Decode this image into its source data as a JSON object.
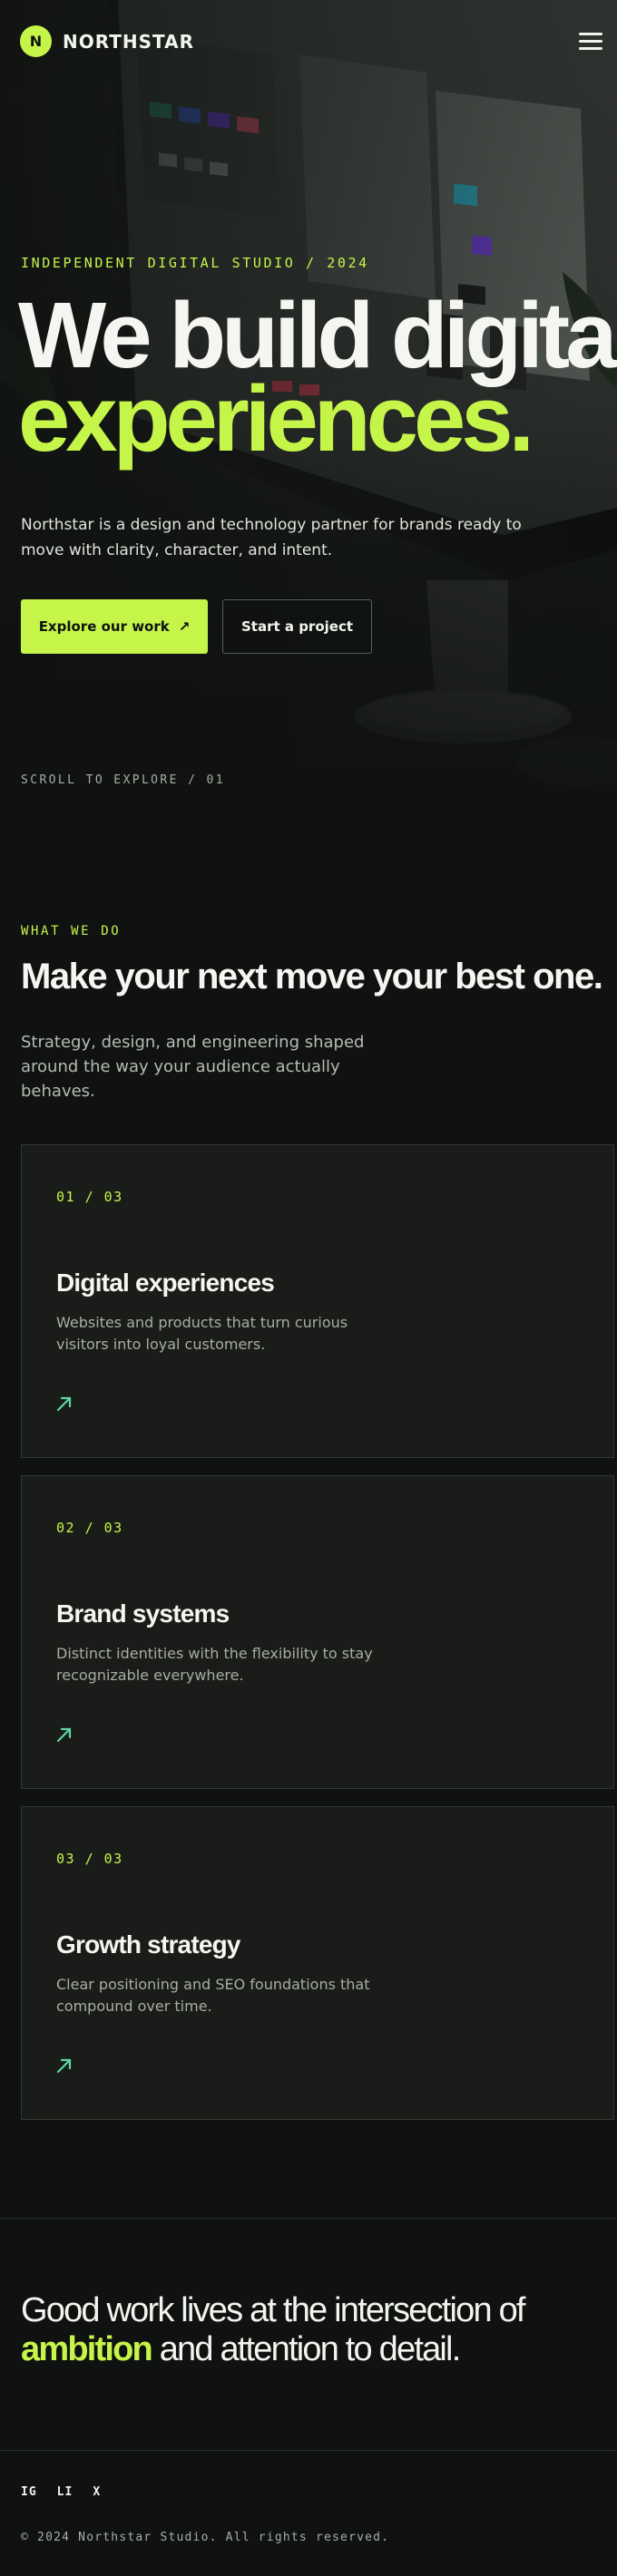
{
  "brand": {
    "mark": "N",
    "name": "NORTHSTAR"
  },
  "hero": {
    "eyebrow": "INDEPENDENT DIGITAL STUDIO / 2024",
    "title_line1": "We build digital",
    "title_line2": "experiences.",
    "lead": "Northstar is a design and technology partner for brands ready to move with clarity, character, and intent.",
    "primary_label": "Explore our work",
    "primary_arrow": "↗",
    "secondary_label": "Start a project",
    "scroll_cue": "SCROLL TO EXPLORE / 01"
  },
  "services": {
    "eyebrow": "WHAT WE DO",
    "title": "Make your next move your best one.",
    "lead": "Strategy, design, and engineering shaped around the way your audience actually behaves.",
    "items": [
      {
        "index": "01 / 03",
        "title": "Digital experiences",
        "desc": "Websites and products that turn curious visitors into loyal customers."
      },
      {
        "index": "02 / 03",
        "title": "Brand systems",
        "desc": "Distinct identities with the flexibility to stay recognizable everywhere."
      },
      {
        "index": "03 / 03",
        "title": "Growth strategy",
        "desc": "Clear positioning and SEO foundations that compound over time."
      }
    ]
  },
  "closing": {
    "line1": "Good work lives at the intersection of",
    "highlight": "ambition",
    "line2_rest": " and attention to detail."
  },
  "footer": {
    "socials": [
      "IG",
      "LI",
      "X"
    ],
    "copyright": "© 2024 Northstar Studio. All rights reserved."
  },
  "colors": {
    "accent": "#c6f54a",
    "background": "#0f1210",
    "card": "#191c18",
    "arrow": "#5fd6a6"
  }
}
